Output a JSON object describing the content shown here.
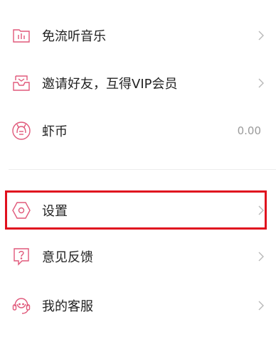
{
  "menu": {
    "items": [
      {
        "label": "免流听音乐",
        "icon": "music-folder-icon"
      },
      {
        "label": "邀请好友，互得VIP会员",
        "icon": "invite-inbox-icon"
      },
      {
        "label": "虾币",
        "icon": "shrimp-coin-icon",
        "value": "0.00"
      },
      {
        "label": "设置",
        "icon": "settings-hexagon-icon"
      },
      {
        "label": "意见反馈",
        "icon": "feedback-question-icon"
      },
      {
        "label": "我的客服",
        "icon": "customer-service-icon"
      }
    ]
  },
  "colors": {
    "icon_accent": "#e0587a",
    "highlight_border": "#e0101e",
    "chevron": "#b8b8b8",
    "value_text": "#9a9a9a"
  }
}
